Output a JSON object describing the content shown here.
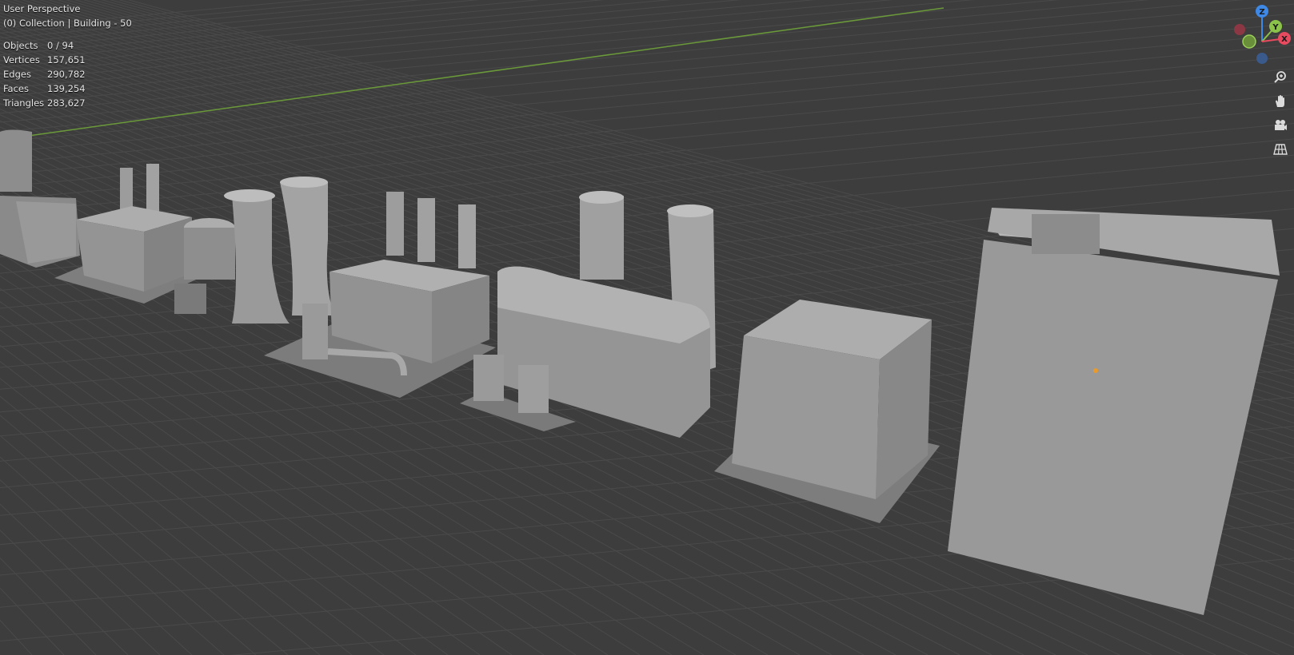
{
  "viewport": {
    "mode": "User Perspective",
    "collection": "(0) Collection | Building - 50"
  },
  "stats": [
    {
      "label": "Objects",
      "value": "0 / 94"
    },
    {
      "label": "Vertices",
      "value": "157,651"
    },
    {
      "label": "Edges",
      "value": "290,782"
    },
    {
      "label": "Faces",
      "value": "139,254"
    },
    {
      "label": "Triangles",
      "value": "283,627"
    }
  ],
  "gizmo": {
    "z_label": "Z",
    "y_label": "Y",
    "x_label": "X",
    "colors": {
      "x": "#e84a5f",
      "y": "#8bc34a",
      "z": "#3e88e6",
      "neg": "#3a5a8c"
    }
  },
  "nav_tools": [
    {
      "name": "zoom-in-icon"
    },
    {
      "name": "pan-hand-icon"
    },
    {
      "name": "camera-view-icon"
    },
    {
      "name": "grid-toggle-icon"
    }
  ],
  "colors": {
    "background": "#3d3d3d",
    "grid_line": "#4a4a4a",
    "y_axis": "#6b9a3a",
    "building": "#9a9a9a"
  }
}
